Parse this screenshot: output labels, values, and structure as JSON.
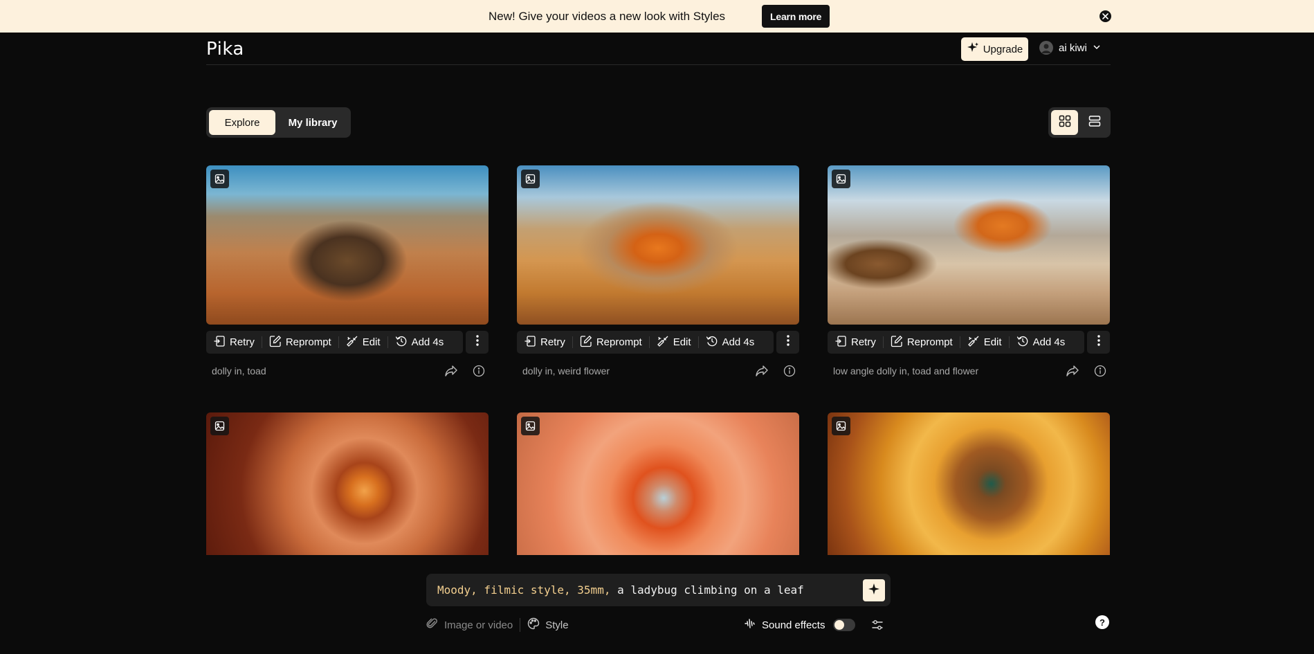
{
  "banner": {
    "text": "New! Give your videos a new look with Styles",
    "button": "Learn more",
    "close_icon": "close-icon"
  },
  "header": {
    "logo": "Pika",
    "upgrade": "Upgrade",
    "user_name": "ai kiwi"
  },
  "tabs": [
    {
      "label": "Explore",
      "active": true
    },
    {
      "label": "My library",
      "active": false
    }
  ],
  "view": {
    "grid_icon": "grid-icon",
    "list_icon": "list-icon",
    "active": "grid"
  },
  "actions": {
    "retry": "Retry",
    "reprompt": "Reprompt",
    "edit": "Edit",
    "add": "Add 4s"
  },
  "cards": [
    {
      "caption": "dolly in, toad"
    },
    {
      "caption": "dolly in, weird flower"
    },
    {
      "caption": "low angle dolly in, toad and flower"
    },
    {
      "caption": ""
    },
    {
      "caption": ""
    },
    {
      "caption": ""
    }
  ],
  "prompt": {
    "style_part": "Moody, filmic style, 35mm,",
    "text_part": " a ladybug climbing on a leaf"
  },
  "bottom": {
    "image_or_video": "Image or video",
    "style": "Style",
    "sound_effects": "Sound effects",
    "sound_on": false
  },
  "help": "?",
  "colors": {
    "accent": "#fdf1dd",
    "background": "#0b0b0b",
    "panel": "#1f1f1f",
    "prompt_style": "#f3cf8f"
  }
}
